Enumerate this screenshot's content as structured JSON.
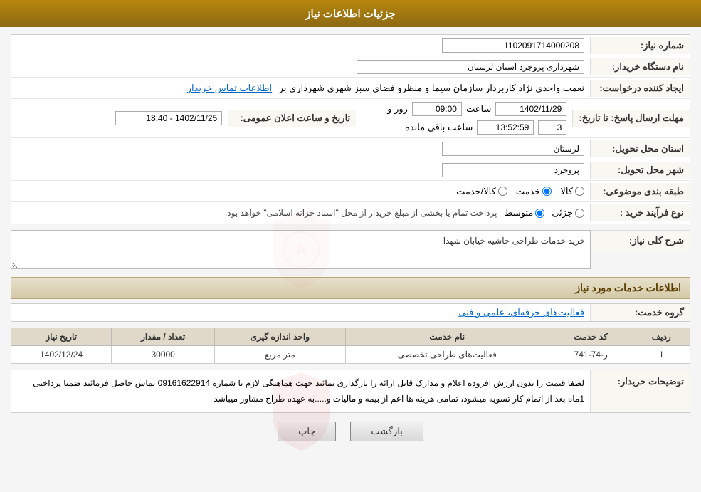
{
  "header": {
    "title": "جزئیات اطلاعات نیاز"
  },
  "fields": {
    "niaaz_number_label": "شماره نیاز:",
    "niaaz_number_value": "1102091714000208",
    "buyer_org_label": "نام دستگاه خریدار:",
    "buyer_org_value": "شهرداری پروجرد استان لرستان",
    "requester_label": "ایجاد کننده درخواست:",
    "requester_value": "نعمت واحدی نژاد کاربردار سازمان سیما و منظرو فضای سبز شهری شهرداری بر",
    "requester_link": "اطلاعات تماس خریدار",
    "deadline_label": "مهلت ارسال پاسخ: تا تاریخ:",
    "deadline_date": "1402/11/29",
    "deadline_time_label": "ساعت",
    "deadline_time": "09:00",
    "deadline_days_label": "روز و",
    "deadline_days": "3",
    "deadline_remaining_label": "ساعت باقی مانده",
    "deadline_remaining": "13:52:59",
    "announce_label": "تاریخ و ساعت اعلان عمومی:",
    "announce_value": "1402/11/25 - 18:40",
    "province_label": "استان محل تحویل:",
    "province_value": "لرستان",
    "city_label": "شهر محل تحویل:",
    "city_value": "پروجرد",
    "category_label": "طبقه بندی موضوعی:",
    "category_goods": "کالا",
    "category_service": "خدمت",
    "category_goods_service": "کالا/خدمت",
    "category_selected": "خدمت",
    "purchase_type_label": "نوع فرآیند خرید :",
    "purchase_part": "جزئی",
    "purchase_medium": "متوسط",
    "purchase_selected": "متوسط",
    "purchase_note": "پرداخت تمام یا بخشی از مبلغ خریدار از محل \"اسناد خزانه اسلامی\" خواهد بود."
  },
  "description_section": {
    "title": "شرح کلی نیاز:",
    "content": "خرید خدمات طراحی حاشیه خیابان شهدا"
  },
  "services_section": {
    "title": "اطلاعات خدمات مورد نیاز",
    "group_label": "گروه خدمت:",
    "group_value": "فعالیت‌های حرفه‌ای، علمی و فنی"
  },
  "table": {
    "columns": [
      "ردیف",
      "کد خدمت",
      "نام خدمت",
      "واحد اندازه گیری",
      "تعداد / مقدار",
      "تاریخ نیاز"
    ],
    "rows": [
      {
        "row": "1",
        "code": "ر-74-741",
        "name": "فعالیت‌های طراحی تخصصی",
        "unit": "متر مربع",
        "quantity": "30000",
        "date": "1402/12/24"
      }
    ]
  },
  "buyer_desc_label": "توضیحات خریدار:",
  "buyer_desc": "لطفا قیمت را بدون ارزش افزوده اعلام و مدارک قابل ارائه را بارگذاری نمائید جهت هماهنگی لازم با شماره 09161622914 تماس حاصل فرمائید ضمنا پرداختی  1ماه بعد از اتمام کار تسویه میشود، تمامی هزینه ها اعم از بیمه و مالیات و.....به عهده طراح مشاور میباشد",
  "buttons": {
    "back": "بازگشت",
    "print": "چاپ"
  }
}
